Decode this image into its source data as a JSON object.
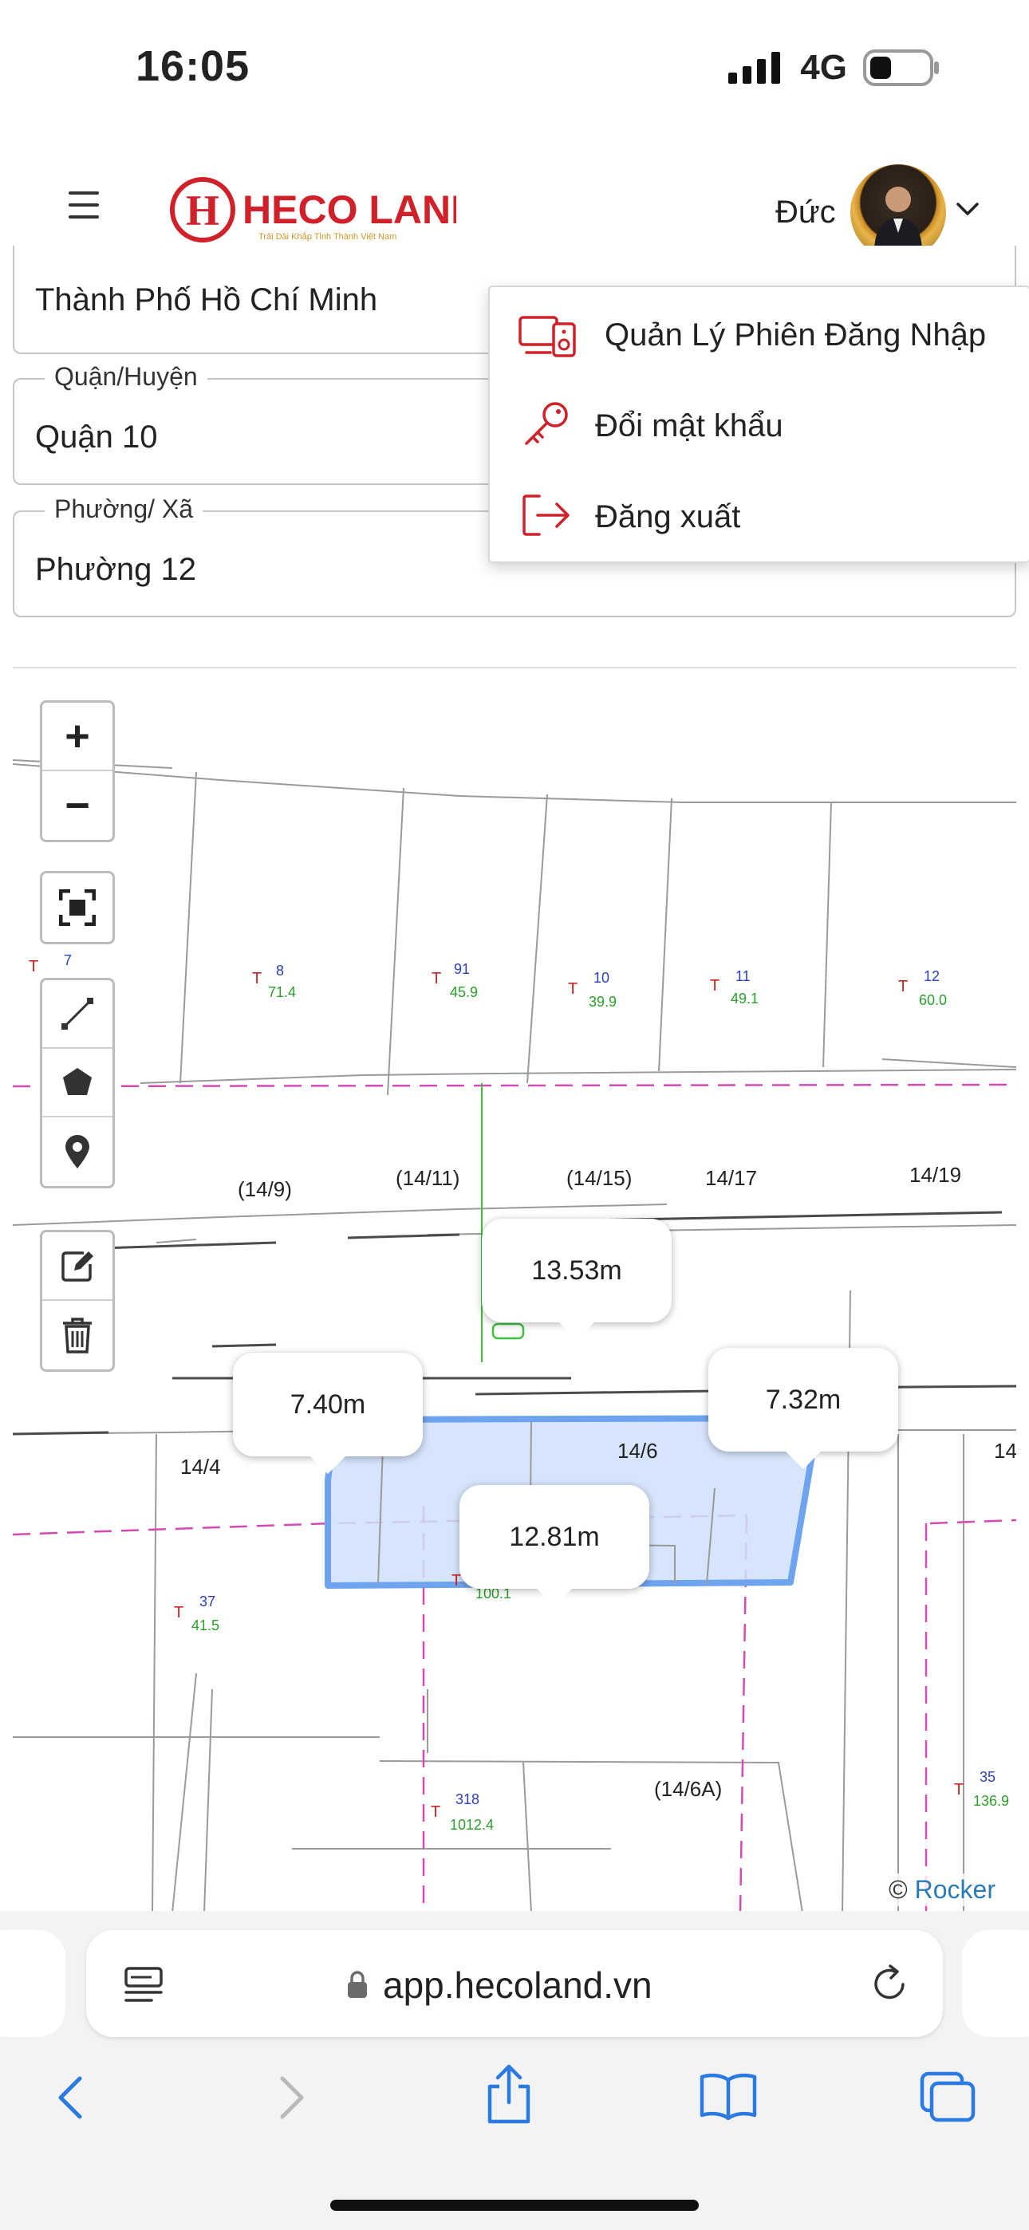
{
  "status_bar": {
    "time": "16:05",
    "network": "4G"
  },
  "header": {
    "logo_text": "HECO LAND",
    "logo_mark": "H",
    "logo_tagline": "Trải Dài Khắp Tỉnh Thành Việt Nam",
    "user_name": "Đức"
  },
  "form": {
    "city": {
      "value": "Thành Phố Hồ Chí Minh"
    },
    "district": {
      "label": "Quận/Huyện",
      "value": "Quận 10"
    },
    "ward": {
      "label": "Phường/ Xã",
      "value": "Phường 12"
    }
  },
  "user_menu": {
    "items": [
      {
        "label": "Quản Lý Phiên Đăng Nhập",
        "icon": "devices-icon"
      },
      {
        "label": "Đổi mật khẩu",
        "icon": "key-icon"
      },
      {
        "label": "Đăng xuất",
        "icon": "logout-icon"
      }
    ]
  },
  "map": {
    "controls": [
      "zoom-in",
      "zoom-out",
      "fullscreen",
      "draw-line",
      "draw-polygon",
      "place-marker",
      "edit",
      "delete"
    ],
    "zoom_in_label": "+",
    "zoom_out_label": "−",
    "measurements": {
      "top": "13.53m",
      "left": "7.40m",
      "right": "7.32m",
      "bottom": "12.81m"
    },
    "lot_labels": {
      "l7": "7",
      "l8": "8",
      "l8a": "71.4",
      "l91": "91",
      "l91a": "45.9",
      "l10": "10",
      "l10a": "39.9",
      "l11": "11",
      "l11a": "49.1",
      "l12": "12",
      "l12a": "60.0",
      "l37": "37",
      "l37a": "41.5",
      "l100": "100.1",
      "l318": "318",
      "l318a": "1012.4",
      "l35": "35",
      "l35a": "136.9"
    },
    "street_labels": {
      "s1": "(14/9)",
      "s2": "(14/11)",
      "s3": "(14/15)",
      "s4": "14/17",
      "s5": "14/19",
      "s6": "14/4",
      "s7": "14/6",
      "s8": "14",
      "s9": "(14/6A)"
    },
    "lot_prefix": "T",
    "attribution_prefix": "©",
    "attribution_link": "Rocker",
    "colors": {
      "polygon_fill": "#cfe0fb",
      "polygon_stroke": "#6ea4ef",
      "boundary_dash": "#d44ab5",
      "measure_line": "#3ec23e",
      "brand_red": "#d0202a"
    }
  },
  "browser": {
    "url": "app.hecoland.vn"
  }
}
